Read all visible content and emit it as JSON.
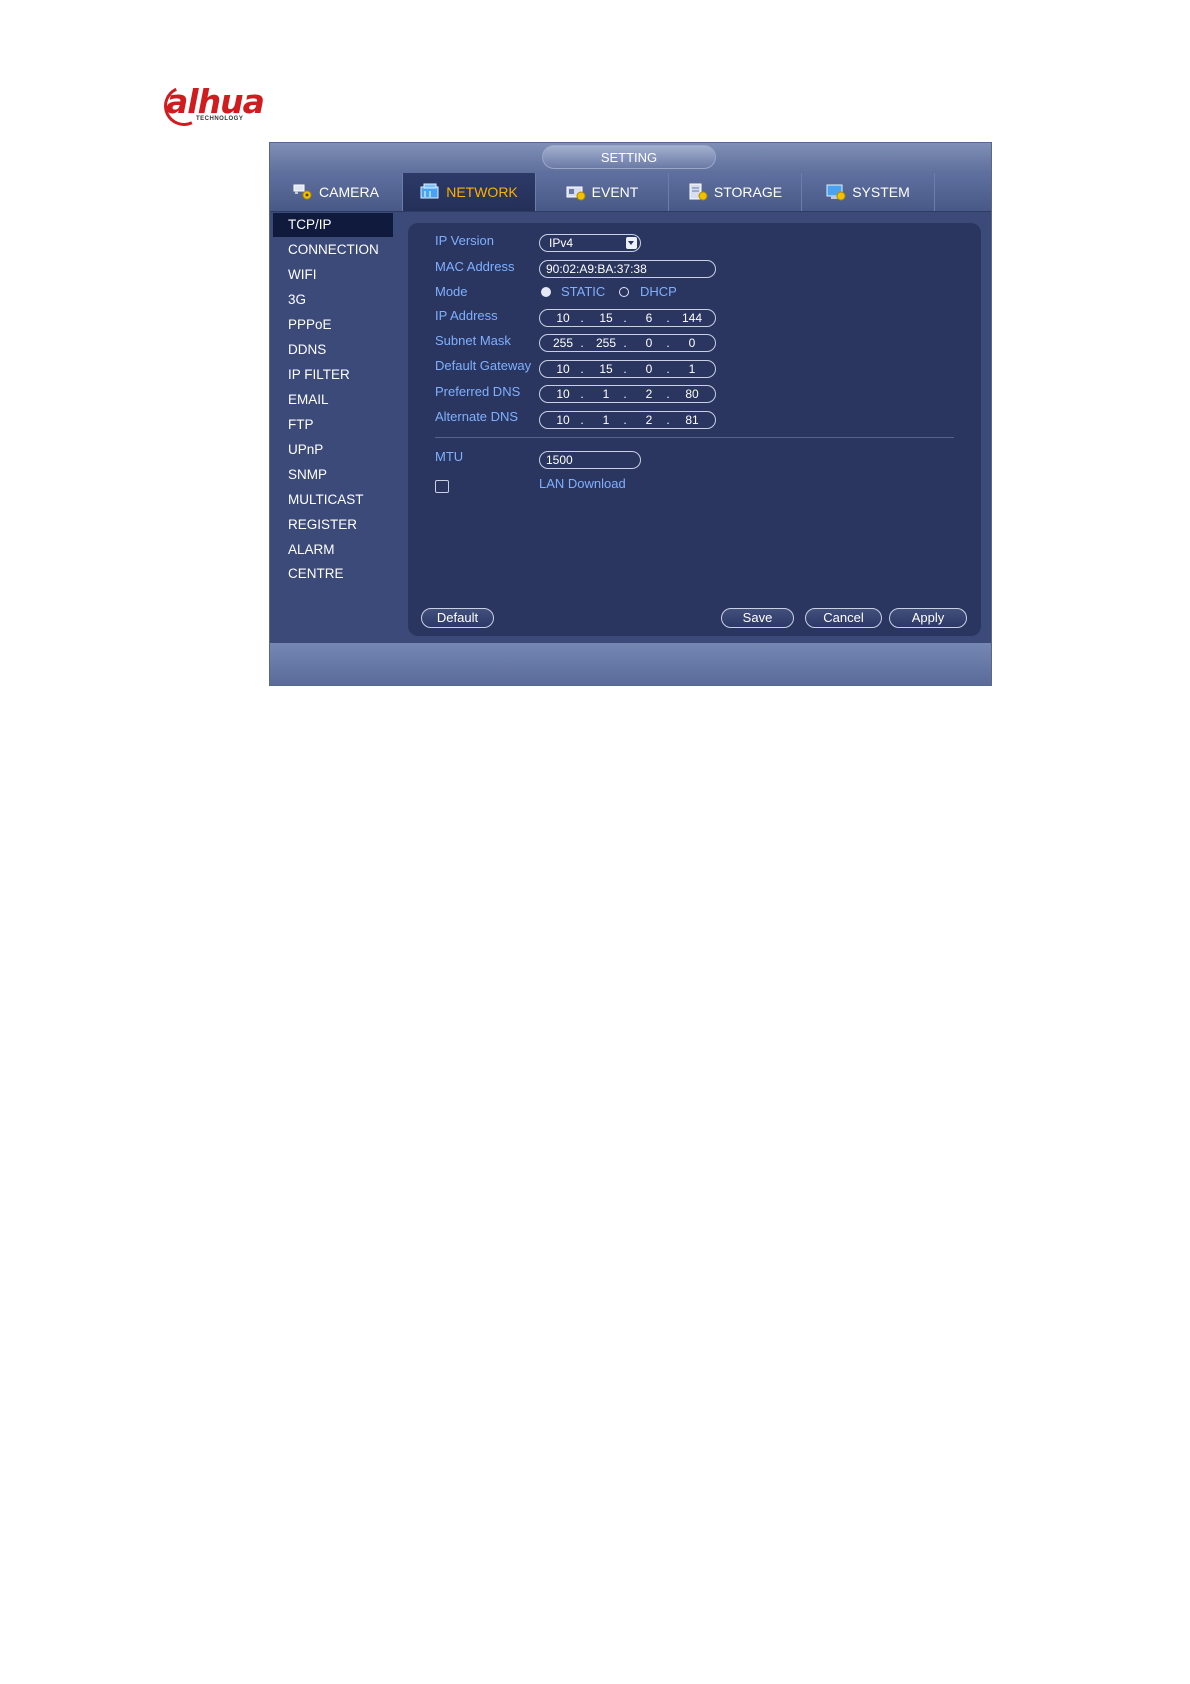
{
  "logo": {
    "brand": "alhua",
    "tagline": "TECHNOLOGY"
  },
  "window": {
    "title": "SETTING"
  },
  "tabs": [
    {
      "label": "CAMERA",
      "icon": "camera-gear-icon"
    },
    {
      "label": "NETWORK",
      "icon": "network-icon"
    },
    {
      "label": "EVENT",
      "icon": "event-icon"
    },
    {
      "label": "STORAGE",
      "icon": "storage-icon"
    },
    {
      "label": "SYSTEM",
      "icon": "system-icon"
    }
  ],
  "active_tab": "NETWORK",
  "sidebar": {
    "items": [
      "TCP/IP",
      "CONNECTION",
      "WIFI",
      "3G",
      "PPPoE",
      "DDNS",
      "IP FILTER",
      "EMAIL",
      "FTP",
      "UPnP",
      "SNMP",
      "MULTICAST",
      "REGISTER",
      "ALARM CENTRE"
    ],
    "active": "TCP/IP"
  },
  "form": {
    "ip_version_label": "IP Version",
    "ip_version_value": "IPv4",
    "mac_label": "MAC Address",
    "mac_value": "90:02:A9:BA:37:38",
    "mode_label": "Mode",
    "mode_static": "STATIC",
    "mode_dhcp": "DHCP",
    "mode_selected": "STATIC",
    "ip_label": "IP Address",
    "ip": [
      "10",
      "15",
      "6",
      "144"
    ],
    "subnet_label": "Subnet Mask",
    "subnet": [
      "255",
      "255",
      "0",
      "0"
    ],
    "gateway_label": "Default Gateway",
    "gateway": [
      "10",
      "15",
      "0",
      "1"
    ],
    "dns1_label": "Preferred DNS",
    "dns1": [
      "10",
      "1",
      "2",
      "80"
    ],
    "dns2_label": "Alternate DNS",
    "dns2": [
      "10",
      "1",
      "2",
      "81"
    ],
    "mtu_label": "MTU",
    "mtu_value": "1500",
    "lan_download_label": "LAN Download",
    "lan_download_checked": false
  },
  "buttons": {
    "default": "Default",
    "save": "Save",
    "cancel": "Cancel",
    "apply": "Apply"
  },
  "colors": {
    "label": "#7fb0ff",
    "active_tab_text": "#ffb000",
    "panel": "#2a3660",
    "window": "#3b4a78"
  }
}
